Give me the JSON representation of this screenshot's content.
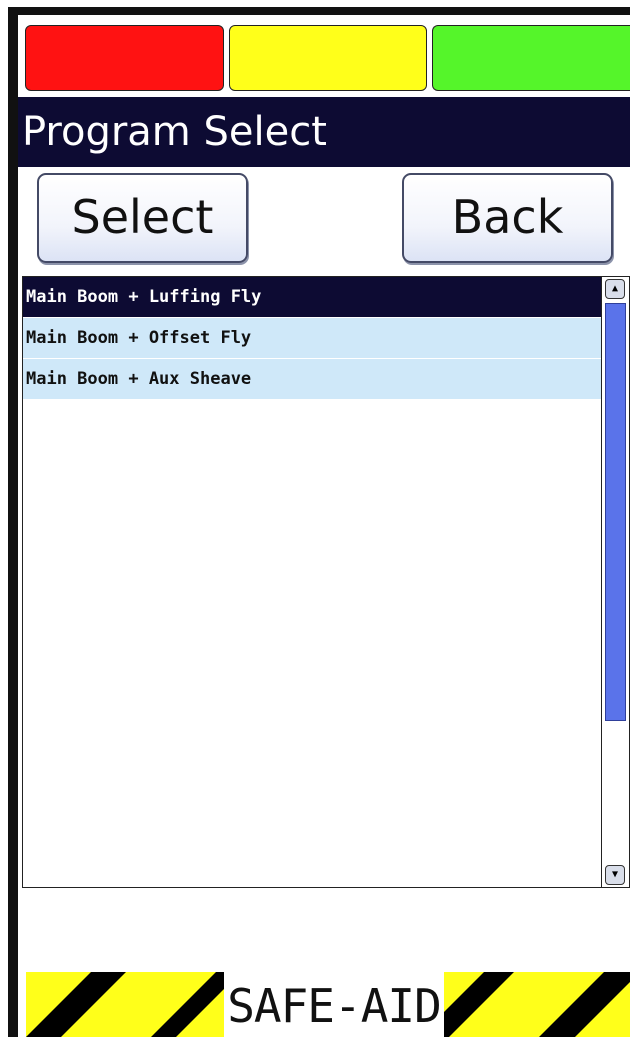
{
  "status": {
    "lamps": [
      {
        "name": "red",
        "color": "#ff1212"
      },
      {
        "name": "yellow",
        "color": "#ffff1a"
      },
      {
        "name": "green",
        "color": "#55f52a"
      }
    ]
  },
  "header": {
    "title": "Program Select"
  },
  "toolbar": {
    "select_label": "Select",
    "back_label": "Back"
  },
  "program_list": {
    "selected_index": 0,
    "items": [
      {
        "label": "Main Boom + Luffing Fly"
      },
      {
        "label": "Main Boom + Offset Fly"
      },
      {
        "label": "Main Boom + Aux Sheave"
      }
    ]
  },
  "footer": {
    "brand": "SAFE-AID",
    "stripe_colors": [
      "#ffff1a",
      "#000000"
    ]
  },
  "icons": {
    "scroll_up": "triangle-up",
    "scroll_down": "triangle-down"
  }
}
